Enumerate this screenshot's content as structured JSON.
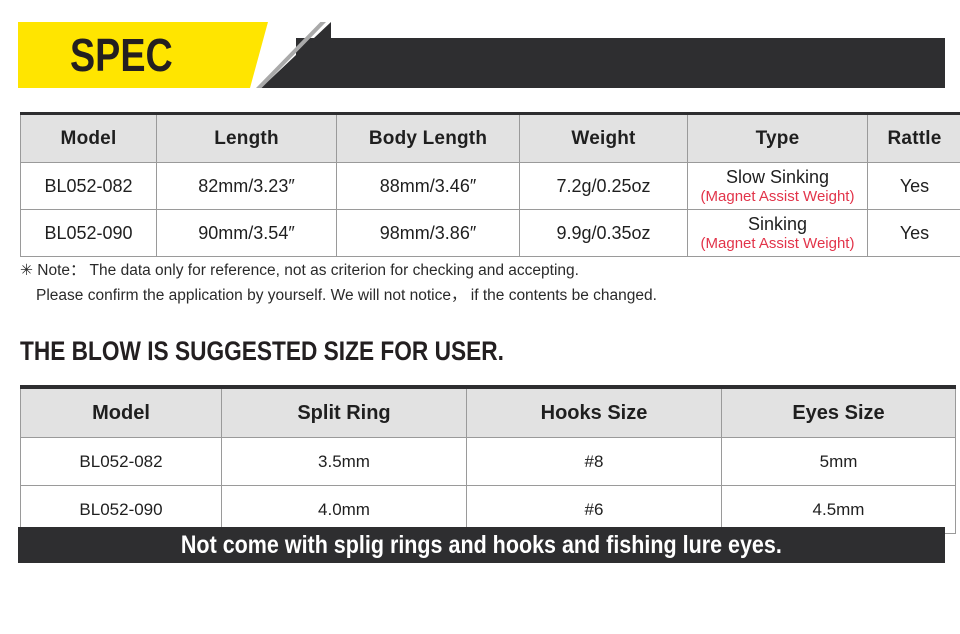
{
  "banner": {
    "title": "SPEC",
    "yellow_color": "#ffe500",
    "dark_color": "#2e2e30",
    "gray_stripe_color": "#a9a9a9"
  },
  "spec_table": {
    "headers": [
      "Model",
      "Length",
      "Body Length",
      "Weight",
      "Type",
      "Rattle"
    ],
    "rows": [
      {
        "model": "BL052-082",
        "length": "82mm/3.23″",
        "body_length": "88mm/3.46″",
        "weight": "7.2g/0.25oz",
        "type_main": "Slow Sinking",
        "type_sub": "(Magnet Assist Weight)",
        "rattle": "Yes"
      },
      {
        "model": "BL052-090",
        "length": "90mm/3.54″",
        "body_length": "98mm/3.86″",
        "weight": "9.9g/0.35oz",
        "type_main": "Sinking",
        "type_sub": "(Magnet Assist Weight)",
        "rattle": "Yes"
      }
    ],
    "accent_red": "#e2344a",
    "header_bg": "#e2e2e2"
  },
  "note": {
    "line1": "✳ Note： The data only for reference, not as criterion for checking and accepting.",
    "line2": "Please confirm the application by yourself.  We will not notice， if the contents be changed."
  },
  "section_heading": "THE BLOW IS SUGGESTED SIZE FOR USER.",
  "size_table": {
    "headers": [
      "Model",
      "Split Ring",
      "Hooks Size",
      "Eyes Size"
    ],
    "rows": [
      {
        "model": "BL052-082",
        "split_ring": "3.5mm",
        "hooks_size": "#8",
        "eyes_size": "5mm"
      },
      {
        "model": "BL052-090",
        "split_ring": "4.0mm",
        "hooks_size": "#6",
        "eyes_size": "4.5mm"
      }
    ]
  },
  "footer": {
    "text": "Not come with splig rings and hooks and fishing lure eyes.",
    "bg_color": "#2e2e30"
  }
}
